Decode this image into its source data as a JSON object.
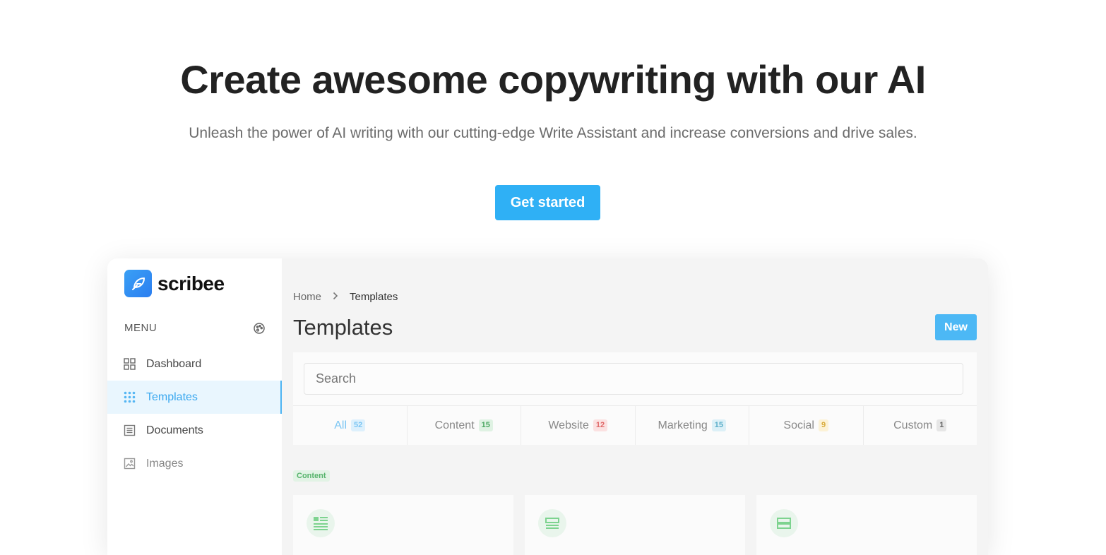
{
  "hero": {
    "title": "Create awesome copywriting with our AI",
    "subtitle": "Unleash the power of AI writing with our cutting-edge Write Assistant and increase conversions and drive sales.",
    "cta_label": "Get started"
  },
  "app": {
    "brand": "scribee",
    "menu_label": "MENU",
    "nav": [
      {
        "label": "Dashboard",
        "icon": "grid-icon"
      },
      {
        "label": "Templates",
        "icon": "dots-grid-icon"
      },
      {
        "label": "Documents",
        "icon": "document-icon"
      },
      {
        "label": "Images",
        "icon": "image-icon"
      }
    ],
    "breadcrumb": {
      "home": "Home",
      "current": "Templates"
    },
    "page_title": "Templates",
    "new_label": "New",
    "search_placeholder": "Search",
    "tabs": [
      {
        "label": "All",
        "count": "52",
        "badge_bg": "#ddf0fc",
        "badge_fg": "#7cc6f3"
      },
      {
        "label": "Content",
        "count": "15",
        "badge_bg": "#dff2e3",
        "badge_fg": "#4aa661"
      },
      {
        "label": "Website",
        "count": "12",
        "badge_bg": "#fbe1e1",
        "badge_fg": "#e06a6a"
      },
      {
        "label": "Marketing",
        "count": "15",
        "badge_bg": "#dcf0f7",
        "badge_fg": "#5aaec9"
      },
      {
        "label": "Social",
        "count": "9",
        "badge_bg": "#fcf2d6",
        "badge_fg": "#d9ac3d"
      },
      {
        "label": "Custom",
        "count": "1",
        "badge_bg": "#e6e6e6",
        "badge_fg": "#666666"
      }
    ],
    "category_tag": "Content",
    "colors": {
      "accent": "#2fb0f5",
      "active_nav_bg": "#e9f6fe"
    }
  }
}
